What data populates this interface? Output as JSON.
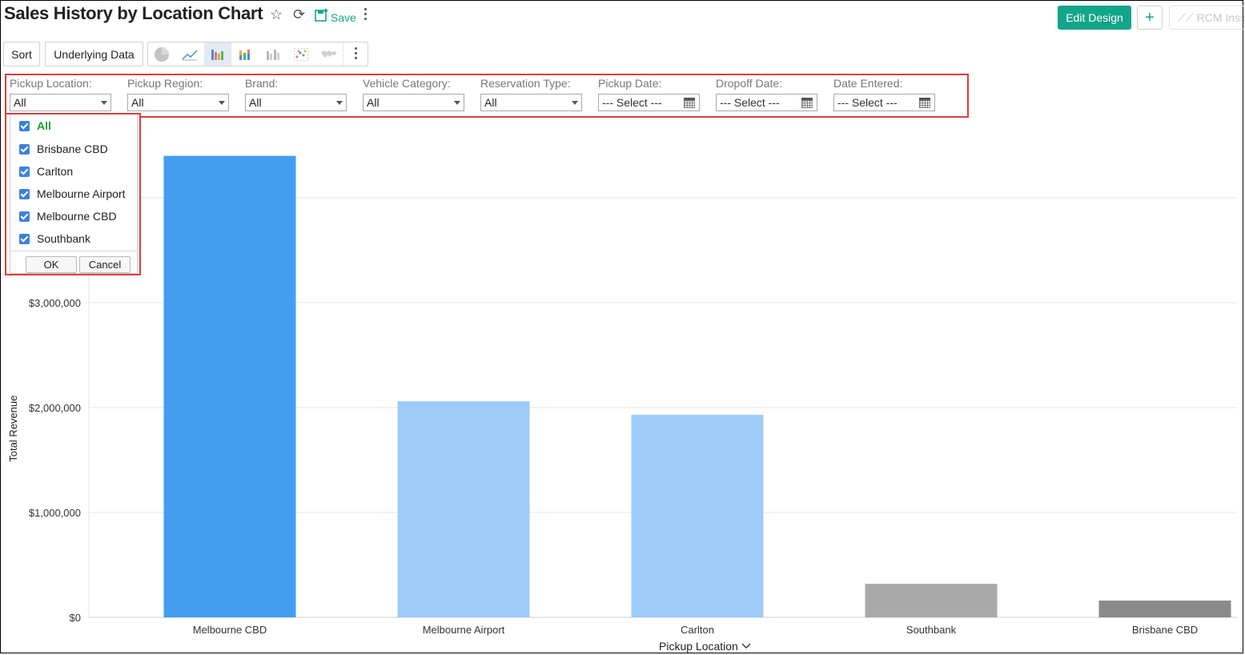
{
  "header": {
    "title": "Sales History by Location Chart",
    "save_label": "Save",
    "edit_design_label": "Edit Design",
    "plus_label": "+",
    "rcm_label": "RCM Insig"
  },
  "toolbar": {
    "sort_label": "Sort",
    "underlying_data_label": "Underlying Data",
    "chart_types": [
      "pie-chart-icon",
      "line-chart-icon",
      "bar-chart-icon",
      "stacked-bar-icon",
      "grouped-bar-icon",
      "scatter-icon",
      "map-icon"
    ],
    "active_chart_type": "bar-chart-icon"
  },
  "filters": [
    {
      "label": "Pickup Location:",
      "value": "All",
      "kind": "select"
    },
    {
      "label": "Pickup Region:",
      "value": "All",
      "kind": "select"
    },
    {
      "label": "Brand:",
      "value": "All",
      "kind": "select"
    },
    {
      "label": "Vehicle Category:",
      "value": "All",
      "kind": "select"
    },
    {
      "label": "Reservation Type:",
      "value": "All",
      "kind": "select"
    },
    {
      "label": "Pickup Date:",
      "value": "--- Select ---",
      "kind": "date"
    },
    {
      "label": "Dropoff Date:",
      "value": "--- Select ---",
      "kind": "date"
    },
    {
      "label": "Date Entered:",
      "value": "--- Select ---",
      "kind": "date"
    }
  ],
  "dropdown": {
    "items": [
      {
        "label": "All",
        "checked": true
      },
      {
        "label": "Brisbane CBD",
        "checked": true
      },
      {
        "label": "Carlton",
        "checked": true
      },
      {
        "label": "Melbourne Airport",
        "checked": true
      },
      {
        "label": "Melbourne CBD",
        "checked": true
      },
      {
        "label": "Southbank",
        "checked": true
      }
    ],
    "ok_label": "OK",
    "cancel_label": "Cancel"
  },
  "colors": {
    "accent": "#13a589",
    "highlight_border": "#e03c3c",
    "bar_dark_blue": "#439ef2",
    "bar_light_blue": "#9ccbf7",
    "bar_gray": "#a9a9a9",
    "bar_dark_gray": "#8a8a8a"
  },
  "chart_data": {
    "type": "bar",
    "categories": [
      "Melbourne CBD",
      "Melbourne Airport",
      "Carlton",
      "Southbank",
      "Brisbane CBD"
    ],
    "values": [
      4400000,
      2060000,
      1930000,
      320000,
      160000
    ],
    "bar_colors": [
      "#439ef2",
      "#9ccbf7",
      "#9ccbf7",
      "#a9a9a9",
      "#8a8a8a"
    ],
    "ylabel": "Total Revenue",
    "xlabel": "Pickup Location",
    "yticks": [
      0,
      1000000,
      2000000,
      3000000
    ],
    "ytick_labels": [
      "$0",
      "$1,000,000",
      "$2,000,000",
      "$3,000,000"
    ],
    "ylim": [
      0,
      4800000
    ],
    "grid": true
  }
}
